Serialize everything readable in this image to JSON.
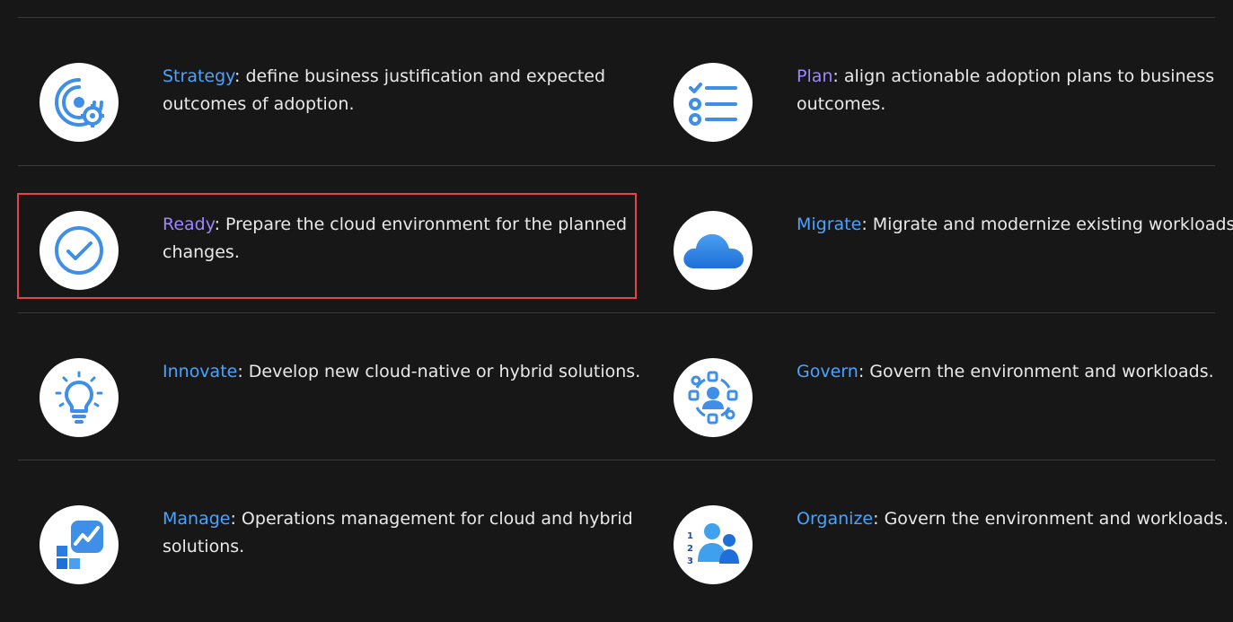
{
  "colors": {
    "background": "#171717",
    "divider": "#3a3a3a",
    "text": "#e9e9e9",
    "highlight_border": "#e5434a",
    "icon_blue": "#3f8ee8"
  },
  "items": [
    {
      "link": "Strategy",
      "link_color": "#4aa3ff",
      "desc": ": define business justification and expected outcomes of adoption.",
      "icon": "strategy-target-gear-icon"
    },
    {
      "link": "Plan",
      "link_color": "#9d86ff",
      "desc": ": align actionable adoption plans to business outcomes.",
      "icon": "plan-checklist-icon"
    },
    {
      "link": "Ready",
      "link_color": "#9d86ff",
      "desc": ": Prepare the cloud environment for the planned changes.",
      "icon": "ready-checkmark-icon"
    },
    {
      "link": "Migrate",
      "link_color": "#4aa3ff",
      "desc": ": Migrate and modernize existing workloads.",
      "icon": "migrate-cloud-icon"
    },
    {
      "link": "Innovate",
      "link_color": "#4aa3ff",
      "desc": ": Develop new cloud-native or hybrid solutions.",
      "icon": "innovate-lightbulb-icon"
    },
    {
      "link": "Govern",
      "link_color": "#4aa3ff",
      "desc": ": Govern the environment and workloads.",
      "icon": "govern-person-network-icon"
    },
    {
      "link": "Manage",
      "link_color": "#4aa3ff",
      "desc": ": Operations management for cloud and hybrid solutions.",
      "icon": "manage-dashboard-chart-icon"
    },
    {
      "link": "Organize",
      "link_color": "#4aa3ff",
      "desc": ": Govern the environment and workloads.",
      "icon": "organize-people-ranking-icon"
    }
  ]
}
